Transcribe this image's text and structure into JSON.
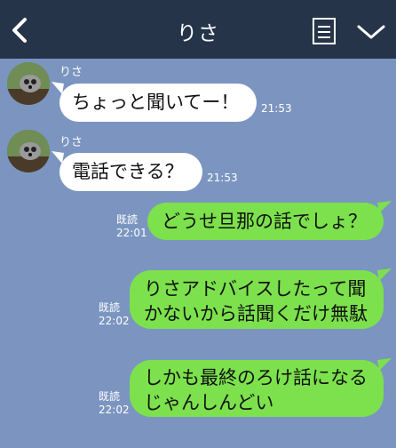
{
  "header": {
    "title": "りさ"
  },
  "colors": {
    "background": "#7b95c0",
    "header": "#253449",
    "incoming_bubble": "#ffffff",
    "outgoing_bubble": "#7ce14c"
  },
  "messages": [
    {
      "direction": "in",
      "sender": "りさ",
      "lines": [
        "ちょっと聞いてー！"
      ],
      "time": "21:53"
    },
    {
      "direction": "in",
      "sender": "りさ",
      "lines": [
        "電話できる？"
      ],
      "time": "21:53"
    },
    {
      "direction": "out",
      "read": "既読",
      "lines": [
        "どうせ旦那の話でしょ？"
      ],
      "time": "22:01"
    },
    {
      "direction": "out",
      "read": "既読",
      "lines": [
        "りさアドバイスしたって聞",
        "かないから話聞くだけ無駄"
      ],
      "time": "22:02"
    },
    {
      "direction": "out",
      "read": "既読",
      "lines": [
        "しかも最終のろけ話になる",
        "じゃんしんどい"
      ],
      "time": "22:02"
    }
  ]
}
